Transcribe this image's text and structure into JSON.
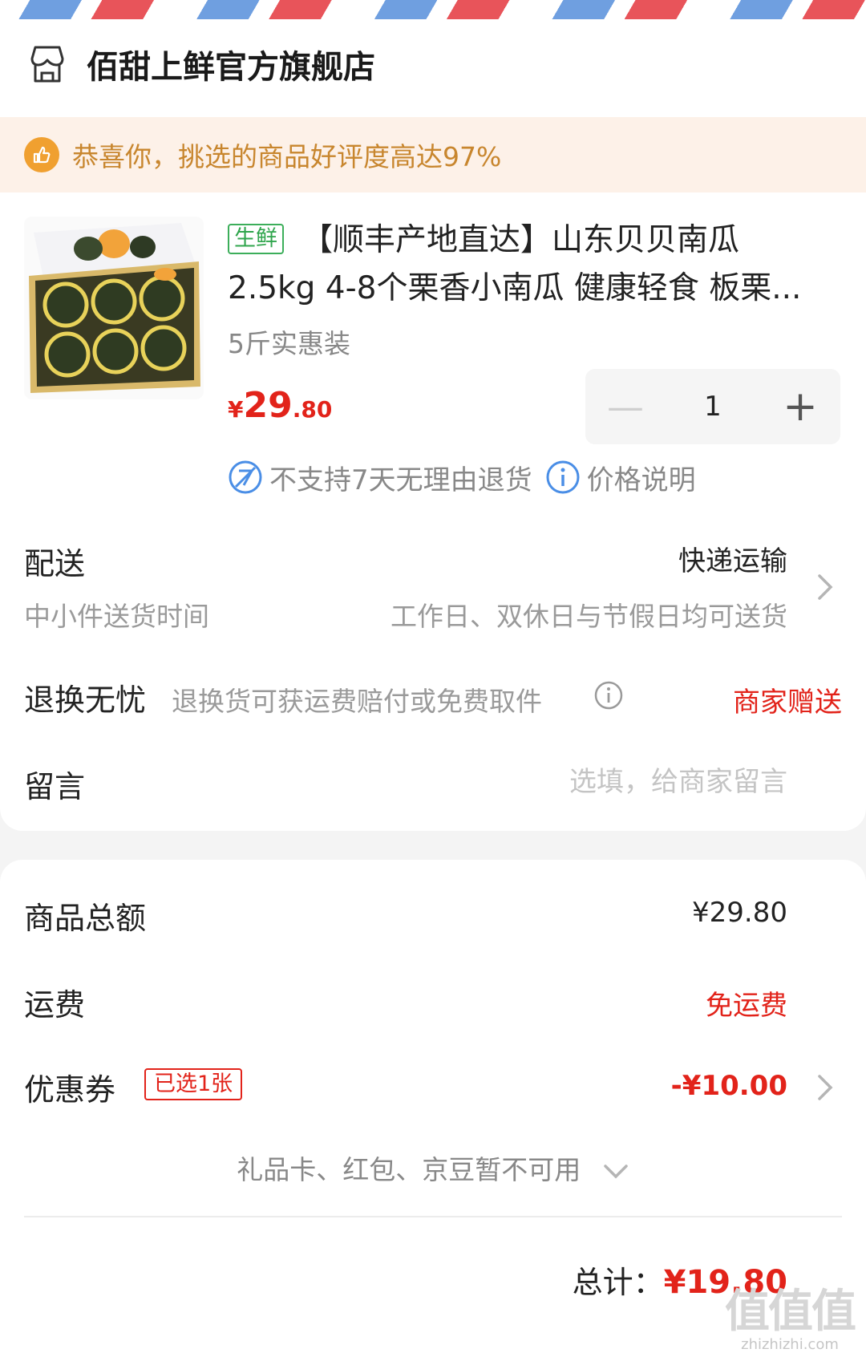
{
  "shop": {
    "name": "佰甜上鲜官方旗舰店",
    "icon": "store-icon"
  },
  "notice": {
    "text": "恭喜你，挑选的商品好评度高达97%",
    "icon": "thumbs-up-icon"
  },
  "product": {
    "tag": "生鲜",
    "title": "【顺丰产地直达】山东贝贝南瓜2.5kg 4-8个栗香小南瓜 健康轻食 板栗...",
    "spec": "5斤实惠装",
    "price_symbol": "¥",
    "price_int": "29",
    "price_dec": ".80",
    "quantity": "1",
    "minus": "—",
    "plus": "+",
    "policy_no_return": "不支持7天无理由退货",
    "policy_price_note": "价格说明"
  },
  "delivery": {
    "label": "配送",
    "value": "快递运输",
    "sub_label": "中小件送货时间",
    "sub_value": "工作日、双休日与节假日均可送货"
  },
  "returns": {
    "label": "退换无忧",
    "desc": "退换货可获运费赔付或免费取件",
    "value": "商家赠送"
  },
  "message": {
    "label": "留言",
    "placeholder": "选填，给商家留言"
  },
  "summary": {
    "goods_label": "商品总额",
    "goods_value": "¥29.80",
    "shipping_label": "运费",
    "shipping_value": "免运费",
    "coupon_label": "优惠券",
    "coupon_badge": "已选1张",
    "coupon_value": "-¥10.00",
    "misc_text": "礼品卡、红包、京豆暂不可用",
    "total_label": "总计：",
    "total_value": "¥19.80"
  },
  "watermark": {
    "glyphs": "值值值",
    "site": "zhizhizhi.com"
  },
  "colors": {
    "accent_red": "#e2231a",
    "fresh_green": "#2fa54c",
    "notice_bg": "#fdf1e8",
    "notice_text": "#c8862e"
  }
}
